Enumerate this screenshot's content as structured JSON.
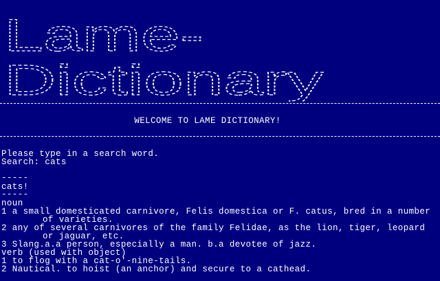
{
  "banner": {
    "line1": "Lame-",
    "line2": "Dictionary"
  },
  "welcome": "WELCOME TO LAME DICTIONARY!",
  "prompt": {
    "instruction": "Please type in a search word.",
    "search_line": "Search: cats"
  },
  "result": {
    "rule_top": "-----",
    "word": "cats!",
    "rule_bottom": "-----",
    "pos_noun": "noun",
    "def1_line1": "1 a small domesticated carnivore, Felis domestica or F. catus, bred in a number",
    "def1_line2": "of varieties.",
    "def2_line1": "2 any of several carnivores of the family Felidae, as the lion, tiger, leopard",
    "def2_line2": "or jaguar, etc.",
    "def3": "3 Slang.a.a person, especially a man. b.a devotee of jazz.",
    "pos_verb": "verb (used with object)",
    "def4": "1 to flog with a cat-o'-nine-tails.",
    "def5": "2 Nautical. to hoist (an anchor) and secure to a cathead."
  },
  "colors": {
    "background": "#00007f",
    "text": "#ffffff"
  }
}
